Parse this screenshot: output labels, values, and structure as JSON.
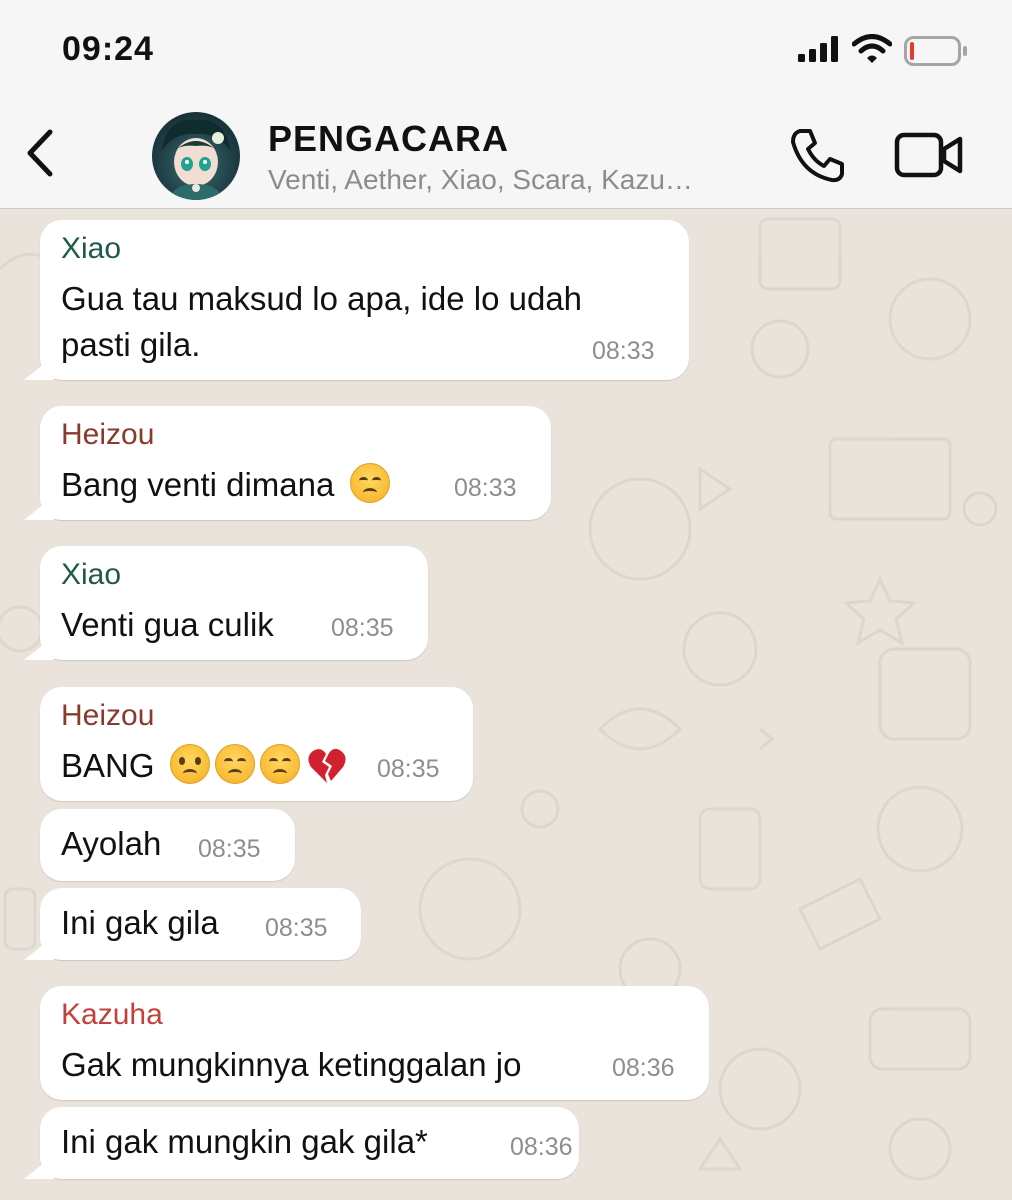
{
  "status": {
    "time": "09:24"
  },
  "header": {
    "title": "PENGACARA",
    "members": "Venti, Aether, Xiao, Scara, Kazu…"
  },
  "colors": {
    "xiao": "#1f5a4b",
    "heizou": "#8a3a2c",
    "kazuha": "#c2413c",
    "timestamp": "#8e8e8e",
    "wallpaper": "#e9e3db"
  },
  "messages": [
    {
      "sender": "Xiao",
      "lines": [
        "Gua tau maksud lo apa, ide lo udah",
        "pasti gila."
      ],
      "time": "08:33"
    },
    {
      "sender": "Heizou",
      "text": "Bang venti dimana",
      "emoji": [
        "pensive-face"
      ],
      "time": "08:33"
    },
    {
      "sender": "Xiao",
      "text": "Venti gua culik",
      "time": "08:35"
    },
    {
      "sender": "Heizou",
      "text": "BANG",
      "emoji": [
        "frowning-face",
        "pensive-face",
        "pensive-face",
        "broken-heart"
      ],
      "time": "08:35"
    },
    {
      "text": "Ayolah",
      "time": "08:35"
    },
    {
      "text": "Ini gak gila",
      "time": "08:35"
    },
    {
      "sender": "Kazuha",
      "text": "Gak mungkinnya ketinggalan jo",
      "time": "08:36"
    },
    {
      "text": "Ini gak mungkin gak gila*",
      "time": "08:36"
    }
  ]
}
